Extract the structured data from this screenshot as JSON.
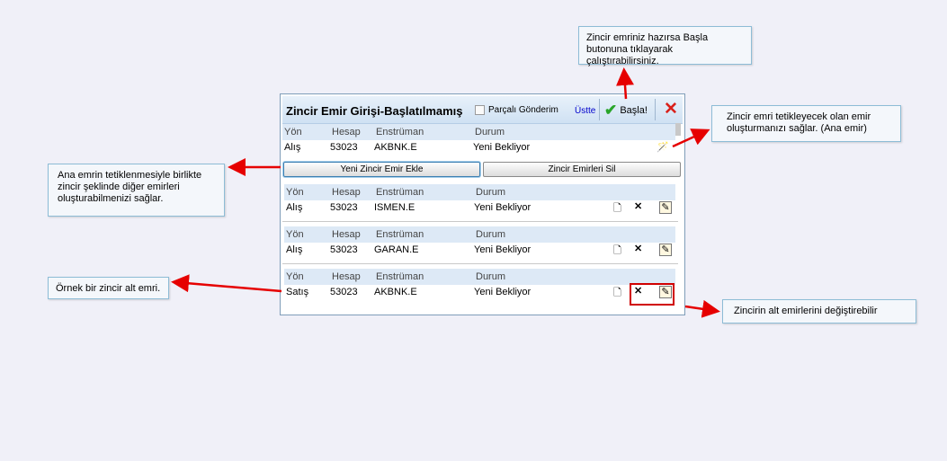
{
  "panel": {
    "title": "Zincir Emir Girişi-Başlatılmamış",
    "partial_send_label": "Parçalı Gönderim",
    "ustte_label": "Üstte",
    "start_label": "Başla!",
    "start_icon": "green-check-icon",
    "close_icon": "red-x-icon",
    "columns": {
      "direction": "Yön",
      "account": "Hesap",
      "instrument": "Enstrüman",
      "status": "Durum"
    },
    "main_order": {
      "direction": "Alış",
      "account": "53023",
      "instrument": "AKBNK.E",
      "status": "Yeni Bekliyor"
    },
    "add_button_label": "Yeni Zincir Emir Ekle",
    "delete_button_label": "Zincir Emirleri Sil",
    "sub_orders": [
      {
        "direction": "Alış",
        "account": "53023",
        "instrument": "ISMEN.E",
        "status": "Yeni Bekliyor"
      },
      {
        "direction": "Alış",
        "account": "53023",
        "instrument": "GARAN.E",
        "status": "Yeni Bekliyor"
      },
      {
        "direction": "Satış",
        "account": "53023",
        "instrument": "AKBNK.E",
        "status": "Yeni Bekliyor"
      }
    ]
  },
  "callouts": {
    "start": "Zincir emriniz hazırsa Başla butonuna tıklayarak çalıştırabilirsiniz.",
    "trigger": "Zincir emri tetikleyecek olan emir oluşturmanızı sağlar. (Ana emir)",
    "chain": "Ana emrin tetiklenmesiyle birlikte zincir şeklinde diğer emirleri oluşturabilmenizi sağlar.",
    "example": "Örnek bir zincir alt emri.",
    "modify": "Zincirin alt emirlerini değiştirebilir"
  },
  "colors": {
    "accent": "#d9201a",
    "callout_border": "#8dbcd6",
    "header_bg": "#dde9f6"
  }
}
